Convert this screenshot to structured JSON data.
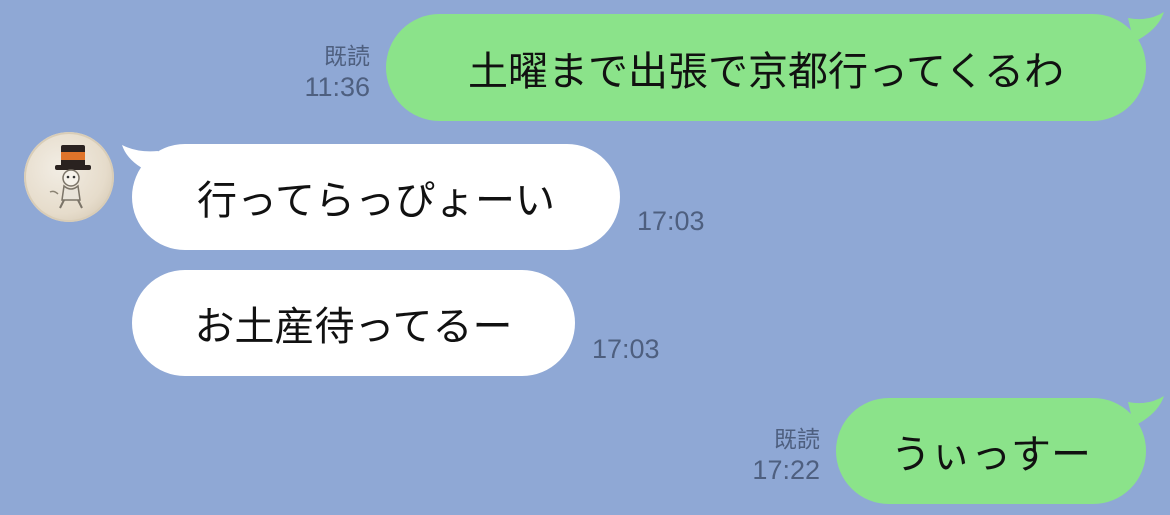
{
  "messages": [
    {
      "sender": "me",
      "text": "土曜まで出張で京都行ってくるわ",
      "read_label": "既読",
      "time": "11:36"
    },
    {
      "sender": "friend",
      "text": "行ってらっぴょーい",
      "time": "17:03"
    },
    {
      "sender": "friend",
      "text": "お土産待ってるー",
      "time": "17:03"
    },
    {
      "sender": "me",
      "text": "うぃっすー",
      "read_label": "既読",
      "time": "17:22"
    }
  ],
  "colors": {
    "background": "#8fa8d5",
    "outgoing_bubble": "#8be38a",
    "incoming_bubble": "#ffffff",
    "meta_text": "#4e5f7f"
  },
  "friend": {
    "avatar_icon": "top-hat-character-avatar"
  }
}
